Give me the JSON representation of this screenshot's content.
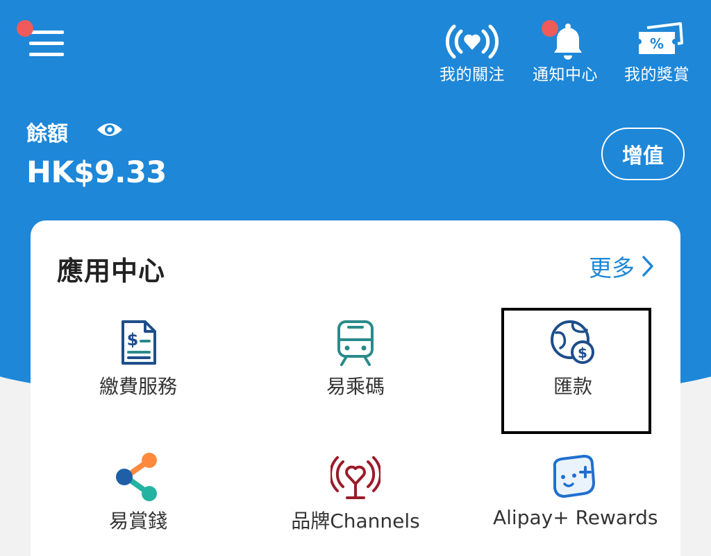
{
  "header": {
    "actions": [
      {
        "label": "我的關注",
        "icon": "heart-broadcast-icon"
      },
      {
        "label": "通知中心",
        "icon": "bell-icon"
      },
      {
        "label": "我的獎賞",
        "icon": "coupon-icon"
      }
    ]
  },
  "balance": {
    "label": "餘額",
    "amount": "HK$9.33",
    "topup_label": "增值"
  },
  "app_center": {
    "title": "應用中心",
    "more_label": "更多",
    "tiles": [
      {
        "label": "繳費服務",
        "icon": "bill-payment-icon"
      },
      {
        "label": "易乘碼",
        "icon": "train-icon"
      },
      {
        "label": "匯款",
        "icon": "globe-remittance-icon"
      },
      {
        "label": "易賞錢",
        "icon": "share-nodes-icon"
      },
      {
        "label": "品牌Channels",
        "icon": "brand-channels-icon"
      },
      {
        "label": "Alipay+ Rewards",
        "icon": "rewards-face-icon"
      }
    ]
  },
  "colors": {
    "primary_blue": "#1e87d8",
    "link_blue": "#1f87d6",
    "badge_red": "#ef5a5a",
    "icon_teal": "#2a8a8a",
    "icon_navy": "#1d4e8a",
    "icon_maroon": "#9b1b2a"
  }
}
